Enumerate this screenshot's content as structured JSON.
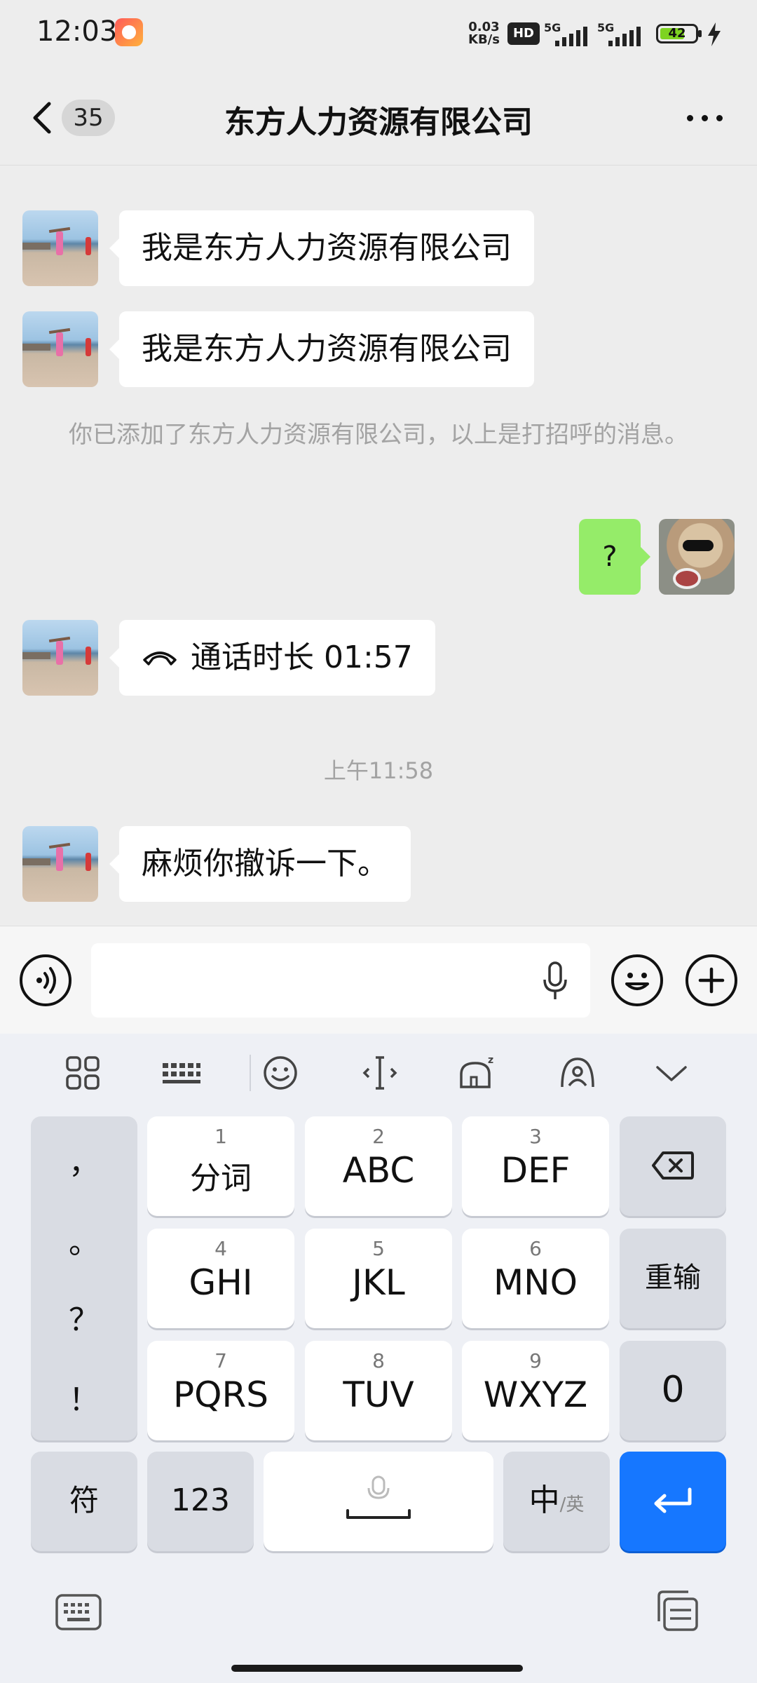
{
  "status_bar": {
    "time": "12:03",
    "net_speed_value": "0.03",
    "net_speed_unit": "KB/s",
    "hd_label": "HD",
    "signal1_label": "5G",
    "signal2_label": "5G",
    "battery_level": "42"
  },
  "header": {
    "unread_count": "35",
    "title": "东方人力资源有限公司"
  },
  "messages": [
    {
      "from": "other",
      "text": "我是东方人力资源有限公司"
    },
    {
      "from": "other",
      "text": "我是东方人力资源有限公司"
    },
    {
      "from": "system",
      "text": "你已添加了东方人力资源有限公司，以上是打招呼的消息。"
    },
    {
      "from": "me",
      "text": "?"
    },
    {
      "from": "other",
      "type": "call",
      "text": "通话时长 01:57"
    },
    {
      "from": "timestamp",
      "text": "上午11:58"
    },
    {
      "from": "other",
      "text": "麻烦你撤诉一下。"
    }
  ],
  "input": {
    "placeholder": ""
  },
  "keyboard": {
    "punct_keys": [
      "，",
      "。",
      "？",
      "！"
    ],
    "keys": [
      {
        "num": "1",
        "label": "分词"
      },
      {
        "num": "2",
        "label": "ABC"
      },
      {
        "num": "3",
        "label": "DEF"
      },
      {
        "num": "4",
        "label": "GHI"
      },
      {
        "num": "5",
        "label": "JKL"
      },
      {
        "num": "6",
        "label": "MNO"
      },
      {
        "num": "7",
        "label": "PQRS"
      },
      {
        "num": "8",
        "label": "TUV"
      },
      {
        "num": "9",
        "label": "WXYZ"
      }
    ],
    "reinput_label": "重输",
    "zero_label": "0",
    "symbol_label": "符",
    "numbers_label": "123",
    "lang_label": "中",
    "lang_sub_label": "/英"
  },
  "colors": {
    "my_bubble": "#95ec69",
    "other_bubble": "#ffffff",
    "enter_key": "#1677ff",
    "chat_bg": "#ededed"
  }
}
